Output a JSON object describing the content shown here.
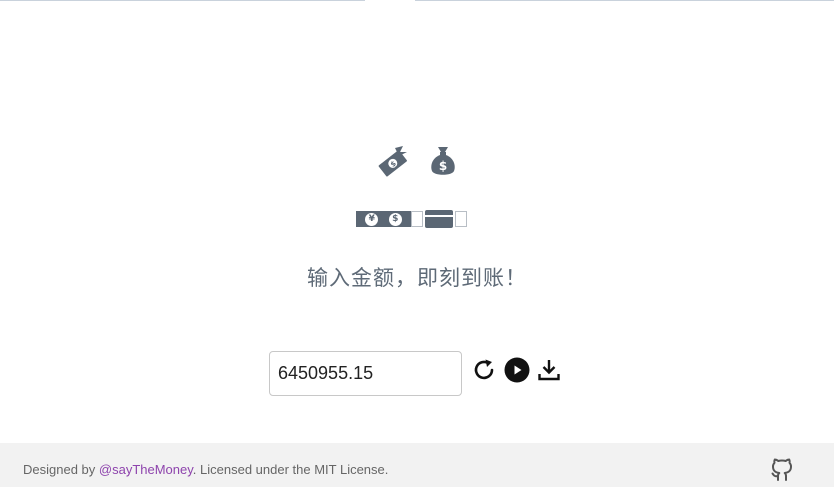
{
  "main": {
    "tagline": "输入金额，即刻到账！",
    "amount_value": "6450955.15",
    "money_strip": {
      "coin_1": "¥",
      "coin_2": "$"
    },
    "icons": {
      "flying_money": "flying-money-icon",
      "money_bag": "money-bag-icon",
      "money_bag_symbol": "$",
      "reset": "refresh-icon",
      "play": "play-icon",
      "download": "download-icon"
    }
  },
  "footer": {
    "prefix": "Designed by ",
    "author_link": "@sayTheMoney",
    "suffix": ". Licensed under the MIT License.",
    "github": "github-icon"
  },
  "colors": {
    "icon_gray": "#5b6774",
    "footer_bg": "#f2f2f2",
    "link": "#8e44ad"
  }
}
